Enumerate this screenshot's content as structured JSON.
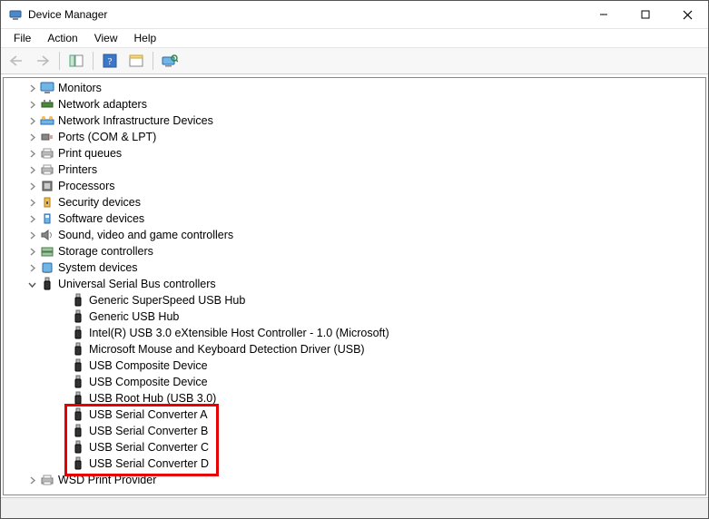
{
  "title": "Device Manager",
  "menu": {
    "file": "File",
    "action": "Action",
    "view": "View",
    "help": "Help"
  },
  "toolbar": {
    "back": "Back",
    "forward": "Forward",
    "show_hide": "Show/Hide Console Tree",
    "help": "Help",
    "properties": "Properties",
    "scan": "Scan for hardware changes"
  },
  "tree": {
    "base_indent": 24,
    "indent_step": 20,
    "categories": [
      {
        "label": "Monitors",
        "icon": "monitor",
        "expanded": false
      },
      {
        "label": "Network adapters",
        "icon": "network",
        "expanded": false
      },
      {
        "label": "Network Infrastructure Devices",
        "icon": "netinfra",
        "expanded": false
      },
      {
        "label": "Ports (COM & LPT)",
        "icon": "port",
        "expanded": false
      },
      {
        "label": "Print queues",
        "icon": "printer",
        "expanded": false
      },
      {
        "label": "Printers",
        "icon": "printer",
        "expanded": false
      },
      {
        "label": "Processors",
        "icon": "cpu",
        "expanded": false
      },
      {
        "label": "Security devices",
        "icon": "security",
        "expanded": false
      },
      {
        "label": "Software devices",
        "icon": "software",
        "expanded": false
      },
      {
        "label": "Sound, video and game controllers",
        "icon": "sound",
        "expanded": false
      },
      {
        "label": "Storage controllers",
        "icon": "storage",
        "expanded": false
      },
      {
        "label": "System devices",
        "icon": "system",
        "expanded": false
      },
      {
        "label": "Universal Serial Bus controllers",
        "icon": "usb",
        "expanded": true,
        "children": [
          {
            "label": "Generic SuperSpeed USB Hub",
            "icon": "usb"
          },
          {
            "label": "Generic USB Hub",
            "icon": "usb"
          },
          {
            "label": "Intel(R) USB 3.0 eXtensible Host Controller - 1.0 (Microsoft)",
            "icon": "usb"
          },
          {
            "label": "Microsoft Mouse and Keyboard Detection Driver (USB)",
            "icon": "usb"
          },
          {
            "label": "USB Composite Device",
            "icon": "usb"
          },
          {
            "label": "USB Composite Device",
            "icon": "usb"
          },
          {
            "label": "USB Root Hub (USB 3.0)",
            "icon": "usb"
          },
          {
            "label": "USB Serial Converter A",
            "icon": "usb",
            "highlighted": true
          },
          {
            "label": "USB Serial Converter B",
            "icon": "usb",
            "highlighted": true
          },
          {
            "label": "USB Serial Converter C",
            "icon": "usb",
            "highlighted": true
          },
          {
            "label": "USB Serial Converter D",
            "icon": "usb",
            "highlighted": true
          }
        ]
      },
      {
        "label": "WSD Print Provider",
        "icon": "printer",
        "expanded": false
      }
    ]
  },
  "highlight": {
    "color": "#e60000"
  }
}
